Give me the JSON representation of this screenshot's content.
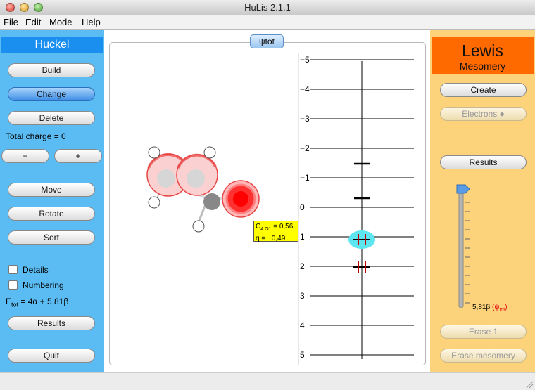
{
  "window": {
    "title": "HuLis 2.1.1"
  },
  "menu": [
    "File",
    "Edit",
    "Mode",
    "Help"
  ],
  "huckel": {
    "header": "Huckel",
    "build": "Build",
    "change": "Change",
    "delete": "Delete",
    "total_charge": "Total charge = 0",
    "minus": "−",
    "plus": "+",
    "move": "Move",
    "rotate": "Rotate",
    "sort": "Sort",
    "details": "Details",
    "numbering": "Numbering",
    "etot_label": "E",
    "etot_sub": "tot",
    "etot_value": " = 4α + 5,81β",
    "results": "Results",
    "quit": "Quit"
  },
  "center": {
    "tab_label": "ψtot",
    "tooltip": {
      "line1_a": "C",
      "line1_sub": "4 O1",
      "line1_b": " = 0,56",
      "line2": "q = −0,49"
    },
    "levels": [
      "−5",
      "−4",
      "−3",
      "−2",
      "−1",
      "0",
      "1",
      "2",
      "3",
      "4",
      "5"
    ]
  },
  "lewis": {
    "header": "Lewis",
    "subheader": "Mesomery",
    "create": "Create",
    "electrons": "Electrons ●",
    "results": "Results",
    "slider_value": "5,81β ",
    "slider_psi": "(ψ",
    "slider_psi_sub": "tot",
    "slider_psi_end": ")",
    "erase1": "Erase 1",
    "erase_mesomery": "Erase mesomery"
  },
  "colors": {
    "huckel_panel": "#5bbcf3",
    "huckel_header": "#1a8ff0",
    "lewis_panel": "#fcd27a",
    "lewis_header": "#ff6a00",
    "tooltip": "#ffff00",
    "orbital_highlight": "#5ee6f0"
  }
}
